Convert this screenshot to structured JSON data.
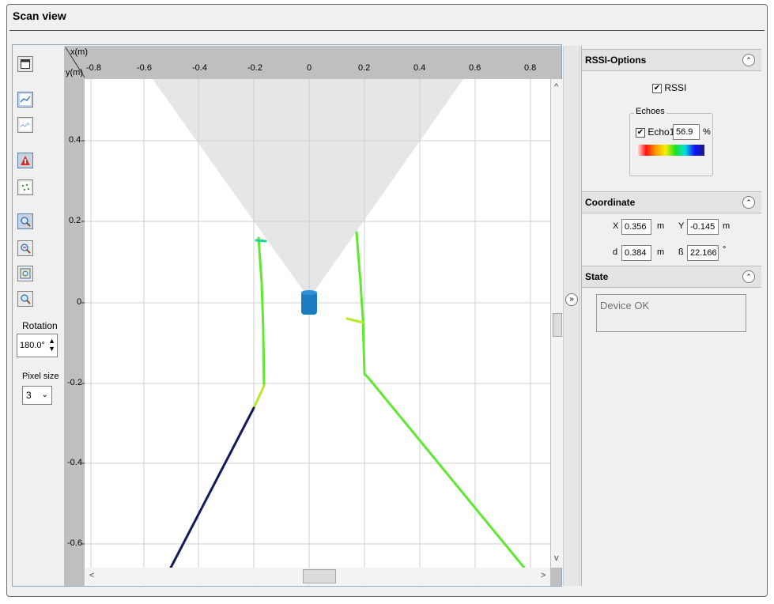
{
  "window": {
    "title": "Scan view"
  },
  "toolbar": {
    "rotation_label": "Rotation",
    "rotation_value": "180.0°",
    "pixel_size_label": "Pixel size",
    "pixel_size_value": "3"
  },
  "plot": {
    "x_axis_label": "x(m)",
    "y_axis_label": "y(m)",
    "x_ticks": [
      "-0.8",
      "-0.6",
      "-0.4",
      "-0.2",
      "0",
      "0.2",
      "0.4",
      "0.6",
      "0.8"
    ],
    "y_ticks": [
      "0.4",
      "0.2",
      "0",
      "-0.2",
      "-0.4",
      "-0.6"
    ],
    "scroll_up": "^",
    "scroll_down": "v",
    "scroll_left": "<",
    "scroll_right": ">"
  },
  "splitter": {
    "expand_glyph": "»"
  },
  "rssi": {
    "header": "RSSI-Options",
    "collapse_glyph": "⌃",
    "rssi_checked": true,
    "rssi_label": "RSSI",
    "echoes_group": "Echoes",
    "echo1_checked": true,
    "echo1_label": "Echo1",
    "echo1_value": "56.9",
    "echo1_unit": "%"
  },
  "coordinate": {
    "header": "Coordinate",
    "x_label": "X",
    "x_value": "0.356",
    "x_unit": "m",
    "y_label": "Y",
    "y_value": "-0.145",
    "y_unit": "m",
    "d_label": "d",
    "d_value": "0.384",
    "d_unit": "m",
    "beta_label": "ß",
    "beta_value": "22.166",
    "beta_unit": "°"
  },
  "state": {
    "header": "State",
    "text": "Device OK"
  },
  "check_glyph": "✔",
  "colors": {
    "scan_green": "#5ee830",
    "scan_dark": "#141a5a",
    "sensor_blue": "#1a7cc0",
    "field_gray": "#e6e6e6"
  },
  "icons": [
    "window-icon",
    "line-chart-icon",
    "scatter-chart-icon",
    "rssi-view-icon",
    "dots-view-icon",
    "zoom-in-icon",
    "zoom-out-icon",
    "zoom-fit-icon",
    "zoom-reset-icon"
  ]
}
